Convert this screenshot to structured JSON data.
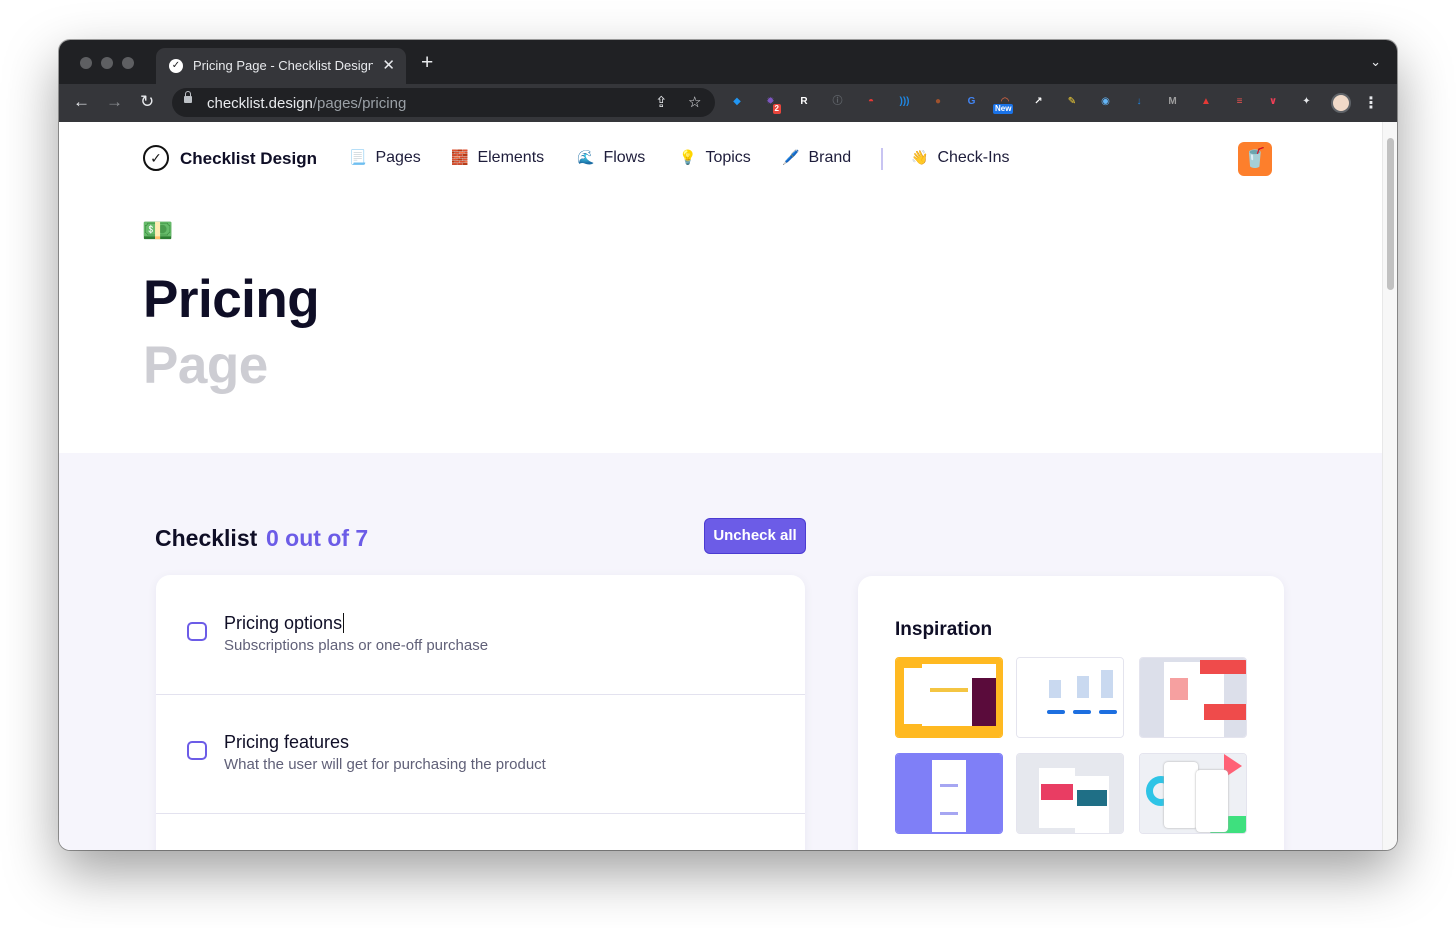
{
  "browser": {
    "tab_title": "Pricing Page - Checklist Design",
    "url_domain": "checklist.design",
    "url_path": "/pages/pricing",
    "extensions": [
      {
        "name": "sapphire-extension-icon",
        "glyph": "◆",
        "color": "#2196f3"
      },
      {
        "name": "gear-star-extension-icon",
        "glyph": "✹",
        "color": "#7e57c2",
        "badge": "2"
      },
      {
        "name": "readwise-extension-icon",
        "glyph": "R",
        "color": "#ffffff"
      },
      {
        "name": "info-extension-icon",
        "glyph": "ⓘ",
        "color": "#5f6368"
      },
      {
        "name": "pokeball-extension-icon",
        "glyph": "◓",
        "color": "#e53935"
      },
      {
        "name": "signal-extension-icon",
        "glyph": ")))",
        "color": "#1e88e5"
      },
      {
        "name": "monkey-extension-icon",
        "glyph": "●",
        "color": "#a0522d"
      },
      {
        "name": "google-translate-extension-icon",
        "glyph": "G",
        "color": "#4285f4"
      },
      {
        "name": "rainbow-extension-icon",
        "glyph": "◠",
        "color": "#ff7043",
        "badge_new": "New"
      },
      {
        "name": "pencil-square-extension-icon",
        "glyph": "↗",
        "color": "#ffffff"
      },
      {
        "name": "highlighter-extension-icon",
        "glyph": "✎",
        "color": "#fdd835"
      },
      {
        "name": "compass-extension-icon",
        "glyph": "◉",
        "color": "#64b5f6"
      },
      {
        "name": "download-extension-icon",
        "glyph": "↓",
        "color": "#1e88e5"
      },
      {
        "name": "m-extension-icon",
        "glyph": "M",
        "color": "#9e9e9e"
      },
      {
        "name": "rooster-extension-icon",
        "glyph": "▲",
        "color": "#e53935"
      },
      {
        "name": "todoist-extension-icon",
        "glyph": "≡",
        "color": "#ef5350"
      },
      {
        "name": "pocket-extension-icon",
        "glyph": "∨",
        "color": "#ef3f56"
      },
      {
        "name": "puzzle-extensions-icon",
        "glyph": "✦",
        "color": "#e8eaed"
      }
    ]
  },
  "site": {
    "brand": "Checklist Design",
    "nav": [
      {
        "icon": "📃",
        "label": "Pages"
      },
      {
        "icon": "🧱",
        "label": "Elements"
      },
      {
        "icon": "🌊",
        "label": "Flows"
      },
      {
        "icon": "💡",
        "label": "Topics"
      },
      {
        "icon": "🖊️",
        "label": "Brand"
      },
      {
        "icon": "👋",
        "label": "Check-Ins"
      }
    ],
    "cup_icon": "🥤"
  },
  "hero": {
    "emoji": "💵",
    "title": "Pricing",
    "subtitle": "Page"
  },
  "checklist": {
    "label": "Checklist",
    "count": "0 out of 7",
    "uncheck_all": "Uncheck all",
    "items": [
      {
        "title": "Pricing options",
        "description": "Subscriptions plans or one-off purchase",
        "checked": false
      },
      {
        "title": "Pricing features",
        "description": "What the user will get for purchasing the product",
        "checked": false
      }
    ]
  },
  "inspiration": {
    "title": "Inspiration",
    "thumbnails": [
      {
        "name": "inspiration-thumb-yellow",
        "bg": "#ffb921"
      },
      {
        "name": "inspiration-thumb-buildings",
        "bg": "#ffffff"
      },
      {
        "name": "inspiration-thumb-red",
        "bg": "#dcdfea"
      },
      {
        "name": "inspiration-thumb-purple",
        "bg": "#7f7ff7"
      },
      {
        "name": "inspiration-thumb-membership",
        "bg": "#e6e8ee"
      },
      {
        "name": "inspiration-thumb-mobile",
        "bg": "#eef0f5"
      }
    ]
  },
  "colors": {
    "accent": "#6c5ce7",
    "heading": "#0f0e26",
    "muted_heading": "#cdcdd3",
    "section_bg": "#f6f5fc",
    "cup_bg": "#fd7f2c"
  }
}
